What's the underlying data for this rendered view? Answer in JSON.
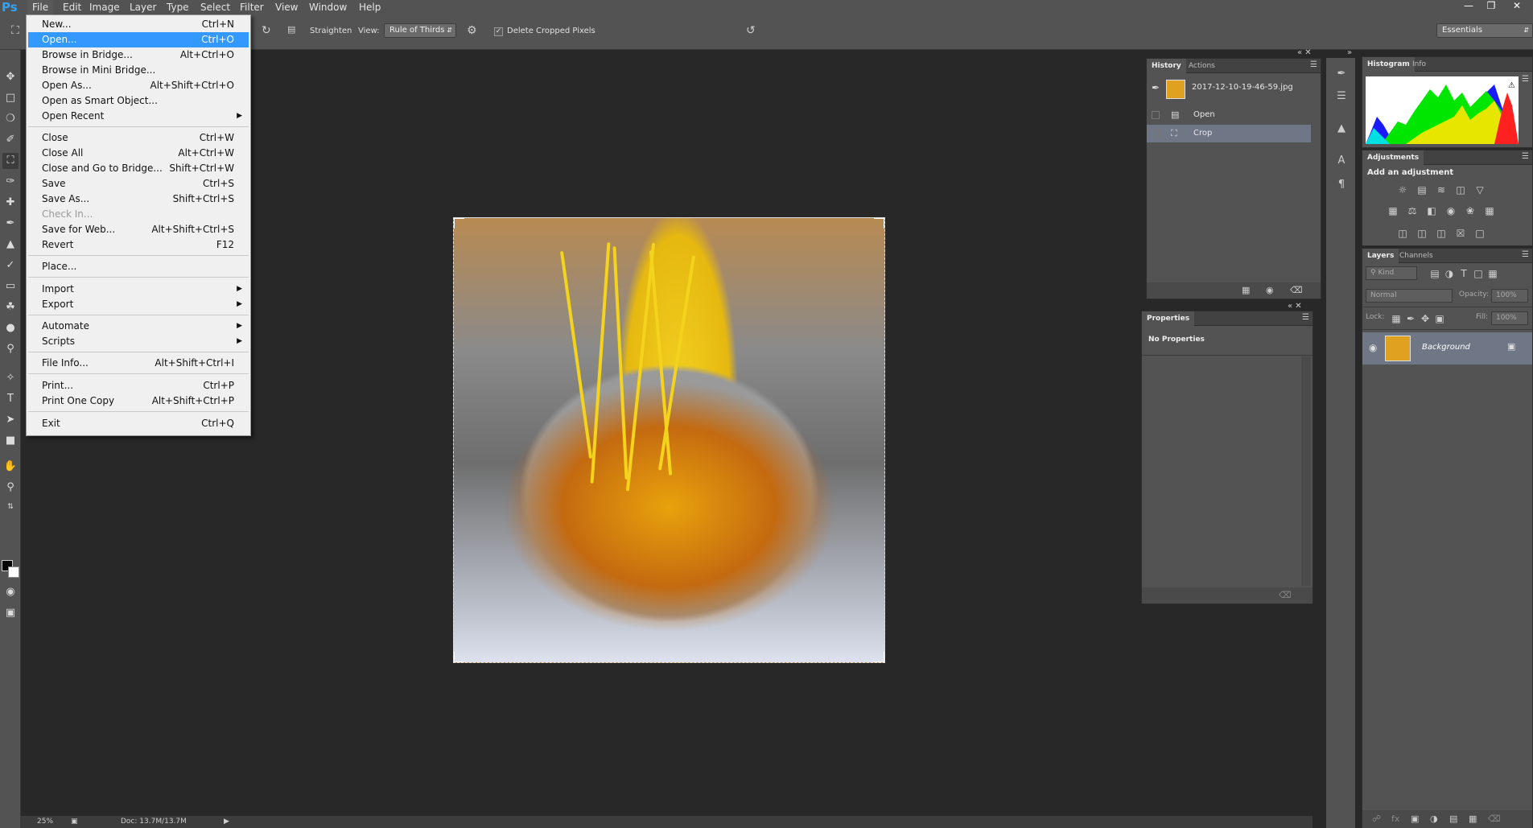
{
  "app": {
    "logo": "Ps"
  },
  "menubar": {
    "items": [
      "File",
      "Edit",
      "Image",
      "Layer",
      "Type",
      "Select",
      "Filter",
      "View",
      "Window",
      "Help"
    ],
    "window_controls": [
      "minimize-icon",
      "restore-icon",
      "close-icon"
    ]
  },
  "options_bar": {
    "straighten_label": "Straighten",
    "view_label": "View:",
    "view_value": "Rule of Thirds",
    "delete_cropped_label": "Delete Cropped Pixels",
    "delete_cropped_checked": true,
    "workspace": "Essentials"
  },
  "file_menu": {
    "items": [
      {
        "label": "New...",
        "shortcut": "Ctrl+N"
      },
      {
        "label": "Open...",
        "shortcut": "Ctrl+O",
        "highlighted": true
      },
      {
        "label": "Browse in Bridge...",
        "shortcut": "Alt+Ctrl+O"
      },
      {
        "label": "Browse in Mini Bridge...",
        "shortcut": ""
      },
      {
        "label": "Open As...",
        "shortcut": "Alt+Shift+Ctrl+O"
      },
      {
        "label": "Open as Smart Object...",
        "shortcut": ""
      },
      {
        "label": "Open Recent",
        "shortcut": "",
        "submenu": true
      },
      {
        "label": "Close",
        "shortcut": "Ctrl+W"
      },
      {
        "label": "Close All",
        "shortcut": "Alt+Ctrl+W"
      },
      {
        "label": "Close and Go to Bridge...",
        "shortcut": "Shift+Ctrl+W"
      },
      {
        "label": "Save",
        "shortcut": "Ctrl+S"
      },
      {
        "label": "Save As...",
        "shortcut": "Shift+Ctrl+S"
      },
      {
        "label": "Check In...",
        "shortcut": "",
        "disabled": true
      },
      {
        "label": "Save for Web...",
        "shortcut": "Alt+Shift+Ctrl+S"
      },
      {
        "label": "Revert",
        "shortcut": "F12"
      },
      {
        "label": "Place...",
        "shortcut": ""
      },
      {
        "label": "Import",
        "shortcut": "",
        "submenu": true
      },
      {
        "label": "Export",
        "shortcut": "",
        "submenu": true
      },
      {
        "label": "Automate",
        "shortcut": "",
        "submenu": true
      },
      {
        "label": "Scripts",
        "shortcut": "",
        "submenu": true
      },
      {
        "label": "File Info...",
        "shortcut": "Alt+Shift+Ctrl+I"
      },
      {
        "label": "Print...",
        "shortcut": "Ctrl+P"
      },
      {
        "label": "Print One Copy",
        "shortcut": "Alt+Shift+Ctrl+P"
      },
      {
        "label": "Exit",
        "shortcut": "Ctrl+Q"
      }
    ]
  },
  "history_panel": {
    "tabs": [
      "History",
      "Actions"
    ],
    "snapshot": "2017-12-10-19-46-59.jpg",
    "states": [
      "Open",
      "Crop"
    ],
    "selected_state": "Crop"
  },
  "properties_panel": {
    "title": "Properties",
    "content": "No Properties"
  },
  "histogram_panel": {
    "tabs": [
      "Histogram",
      "Info"
    ]
  },
  "adjustments_panel": {
    "title": "Adjustments",
    "subtitle": "Add an adjustment"
  },
  "layers_panel": {
    "tabs": [
      "Layers",
      "Channels"
    ],
    "filter_kind": "Kind",
    "blend_mode": "Normal",
    "opacity_label": "Opacity:",
    "opacity_value": "100%",
    "lock_label": "Lock:",
    "fill_label": "Fill:",
    "fill_value": "100%",
    "layers": [
      {
        "name": "Background",
        "locked": true,
        "visible": true
      }
    ]
  },
  "status_bar": {
    "zoom": "25%",
    "doc_info": "Doc: 13.7M/13.7M"
  },
  "colors": {
    "ui_bg": "#535353",
    "canvas_bg": "#282828",
    "menu_highlight": "#3399ff",
    "history_selected": "#6f7787",
    "layer_selected": "#6f7787"
  }
}
